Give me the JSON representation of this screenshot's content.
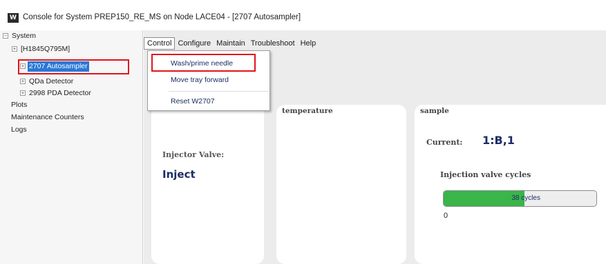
{
  "window": {
    "app_icon": "W",
    "title": "Console for System PREP150_RE_MS on Node LACE04 - [2707 Autosampler]"
  },
  "tree": {
    "items": [
      {
        "label": "System",
        "expander": "−"
      },
      {
        "label": "[H1845Q795M]",
        "expander": "+"
      },
      {
        "label": "2707 Autosampler",
        "expander": "+"
      },
      {
        "label": "QDa Detector",
        "expander": "+"
      },
      {
        "label": "2998 PDA Detector",
        "expander": "+"
      },
      {
        "label": "Plots"
      },
      {
        "label": "Maintenance Counters"
      },
      {
        "label": "Logs"
      }
    ]
  },
  "menu": {
    "items": [
      "Control",
      "Configure",
      "Maintain",
      "Troubleshoot",
      "Help"
    ]
  },
  "control_menu": {
    "items": [
      "Wash/prime needle",
      "Move tray forward",
      "Reset W2707"
    ]
  },
  "panels": {
    "injector": {
      "label": "Injector Valve:",
      "value": "Inject"
    },
    "temperature": {
      "title": "temperature"
    },
    "sample": {
      "title": "sample",
      "current_label": "Current:",
      "current_value": "1:B,1",
      "cycles_label": "Injection valve cycles",
      "cycles_text": "38 cycles",
      "cycles_min": "0",
      "cycles_fraction": 0.53
    }
  },
  "colors": {
    "highlight": "#e0141b",
    "selection": "#2a78d6",
    "progress": "#39b54a",
    "value_text": "#1b2d63"
  }
}
